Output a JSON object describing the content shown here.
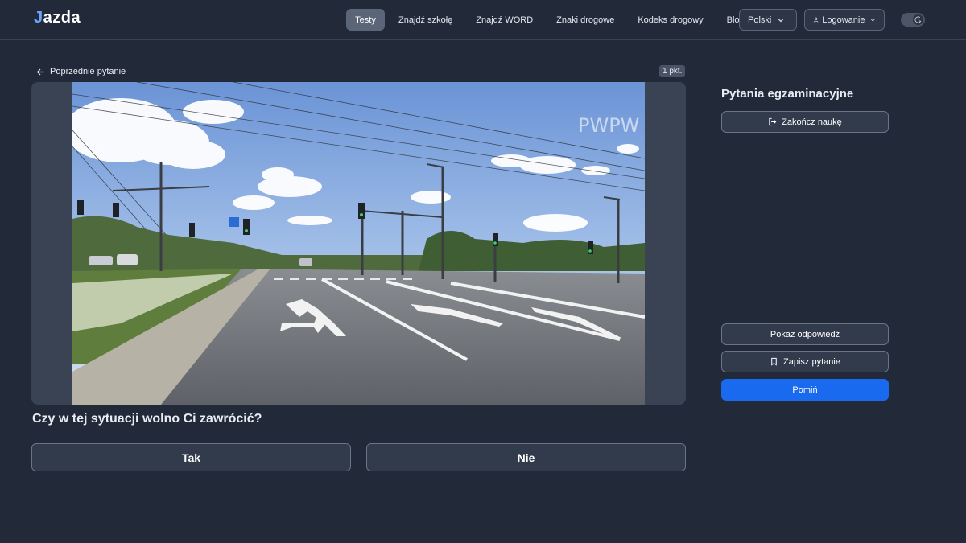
{
  "header": {
    "logo": "jazda",
    "nav": [
      {
        "label": "Testy",
        "active": true
      },
      {
        "label": "Znajdź szkołę",
        "active": false
      },
      {
        "label": "Znajdź WORD",
        "active": false
      },
      {
        "label": "Znaki drogowe",
        "active": false
      },
      {
        "label": "Kodeks drogowy",
        "active": false
      },
      {
        "label": "Blog",
        "active": false
      }
    ],
    "language": "Polski",
    "login": "Logowanie",
    "theme": "dark"
  },
  "question": {
    "prev_label": "Poprzednie pytanie",
    "points": "1 pkt.",
    "media_watermark": "PWPW",
    "text": "Czy w tej sytuacji wolno Ci zawrócić?",
    "answers": [
      "Tak",
      "Nie"
    ]
  },
  "sidebar": {
    "title": "Pytania egzaminacyjne",
    "finish_label": "Zakończ naukę",
    "show_answer_label": "Pokaż odpowiedź",
    "save_label": "Zapisz pytanie",
    "skip_label": "Pomiń"
  },
  "colors": {
    "background": "#222a3a",
    "accent": "#1a6af0",
    "button": "#323b4c"
  }
}
